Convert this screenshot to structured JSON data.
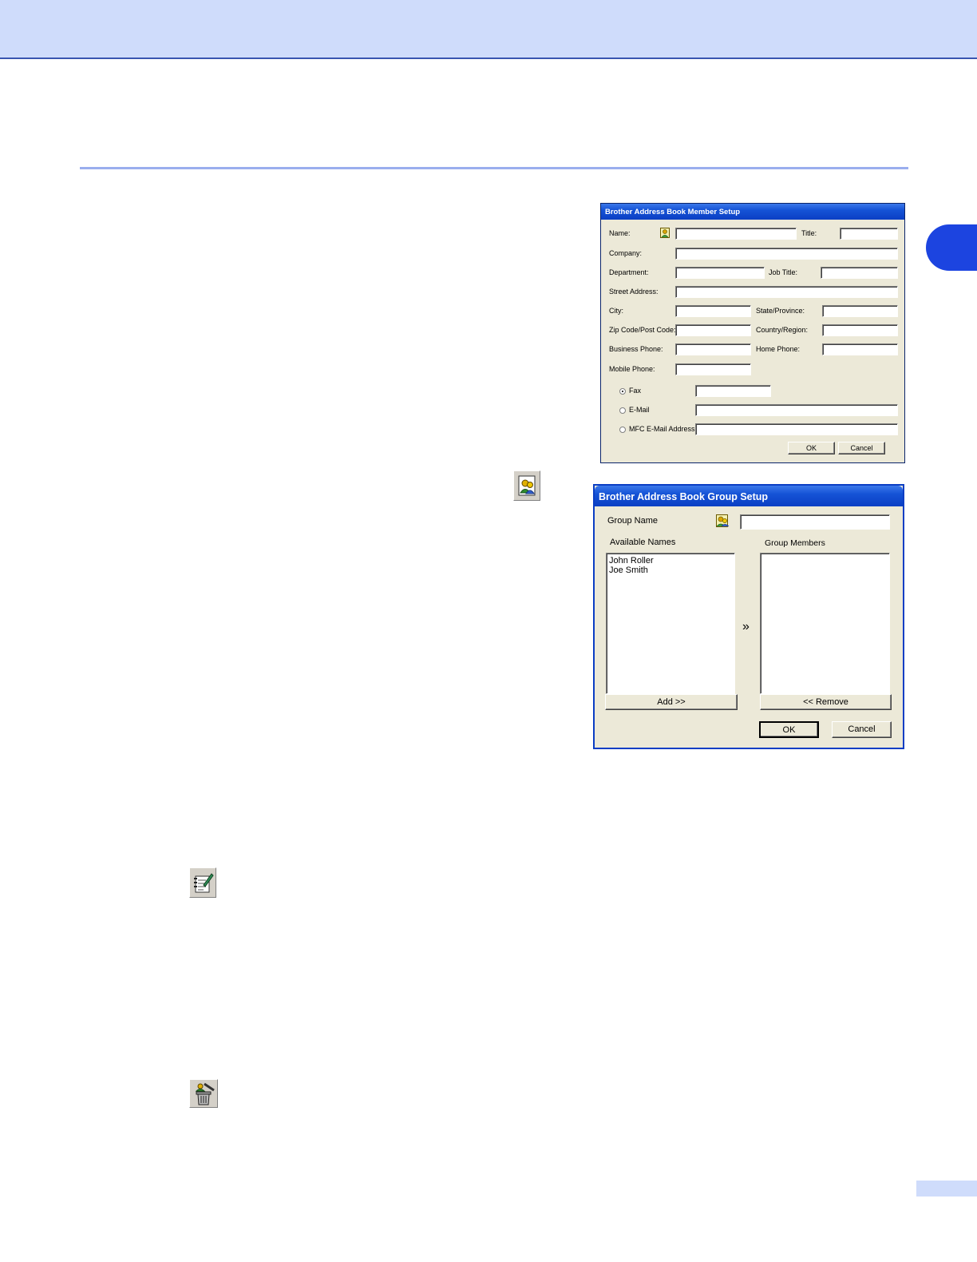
{
  "member_dialog": {
    "title": "Brother Address Book Member Setup",
    "fields": {
      "name": "Name:",
      "title": "Title:",
      "company": "Company:",
      "department": "Department:",
      "job_title": "Job Title:",
      "street": "Street Address:",
      "city": "City:",
      "state": "State/Province:",
      "zip": "Zip Code/Post Code:",
      "country": "Country/Region:",
      "business_phone": "Business Phone:",
      "home_phone": "Home Phone:",
      "mobile_phone": "Mobile Phone:"
    },
    "radios": {
      "fax": "Fax",
      "email": "E-Mail",
      "mfc_email": "MFC E-Mail Address:"
    },
    "ok": "OK",
    "cancel": "Cancel"
  },
  "group_dialog": {
    "title": "Brother Address Book Group Setup",
    "group_name_label": "Group Name",
    "available_label": "Available Names",
    "members_label": "Group Members",
    "available_names": [
      "John Roller",
      "Joe Smith"
    ],
    "arrow": "»",
    "add": "Add >>",
    "remove": "<< Remove",
    "ok": "OK",
    "cancel": "Cancel"
  },
  "icons": {
    "new_group": "new-group-icon",
    "edit": "edit-icon",
    "delete": "delete-icon"
  }
}
